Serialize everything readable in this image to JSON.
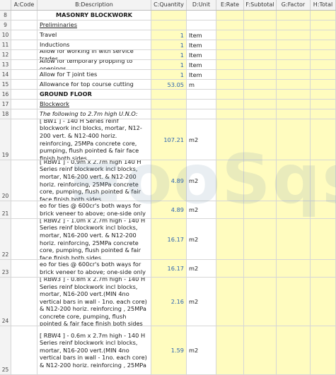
{
  "columns": [
    "",
    "A:Code",
    "B:Description",
    "C:Quantity",
    "D:Unit",
    "E:Rate",
    "F:Subtotal",
    "G:Factor",
    "H:Total"
  ],
  "rows": [
    {
      "num": "8",
      "desc": "MASONRY BLOCKWORK",
      "qty": "",
      "unit": "",
      "style": "b center",
      "h": 14
    },
    {
      "num": "9",
      "desc": "Preliminaries",
      "qty": "",
      "unit": "",
      "style": "u",
      "h": 14
    },
    {
      "num": "10",
      "desc": "Travel",
      "qty": "1",
      "unit": "Item",
      "style": "",
      "h": 14
    },
    {
      "num": "11",
      "desc": "Inductions",
      "qty": "1",
      "unit": "Item",
      "style": "",
      "h": 14
    },
    {
      "num": "12",
      "desc": "Allow for working in with service trades",
      "qty": "1",
      "unit": "Item",
      "style": "",
      "h": 14
    },
    {
      "num": "13",
      "desc": "Allow for temporary propping to openings",
      "qty": "1",
      "unit": "Item",
      "style": "",
      "h": 14
    },
    {
      "num": "14",
      "desc": "Allow for T joint ties",
      "qty": "1",
      "unit": "Item",
      "style": "",
      "h": 14
    },
    {
      "num": "15",
      "desc": "Allowance for top course cutting",
      "qty": "53.05",
      "unit": "m",
      "style": "",
      "h": 14
    },
    {
      "num": "16",
      "desc": "GROUND FLOOR",
      "qty": "",
      "unit": "",
      "style": "b",
      "h": 14
    },
    {
      "num": "17",
      "desc": "Blockwork",
      "qty": "",
      "unit": "",
      "style": "u",
      "h": 14
    },
    {
      "num": "18",
      "desc": "The following to 2.7m high U.N.O:",
      "qty": "",
      "unit": "",
      "style": "i",
      "h": 14
    },
    {
      "num": "19",
      "desc": "[ BW1 ] - 140 H Series reinf blockwork incl blocks, mortar, N12-200 vert. & N12-400 horiz. reinforcing, 25MPa concrete core, pumping, flush pointed & fair face finish both sides",
      "qty": "107.21",
      "unit": "m2",
      "style": "",
      "h": 58
    },
    {
      "num": "20",
      "desc": "[ RBW1 ] - 0.9m x 2.7m high 140 H Series reinf blockwork incl blocks, mortar, N16-200 vert. & N12-200 horiz. reinforcing, 25MPa concrete core, pumping, flush pointed & fair face finish both sides",
      "qty": "4.89",
      "unit": "m2",
      "style": "",
      "h": 58
    },
    {
      "num": "21",
      "desc": "eo for ties @ 600cr's both ways for brick veneer to above; one-side only",
      "qty": "4.89",
      "unit": "m2",
      "style": "",
      "h": 25
    },
    {
      "num": "22",
      "desc": "[ RBW2 ] - 1.0m x 2.7m high - 140 H Series reinf blockwork incl blocks, mortar, N16-200 vert. & N12-200 horiz. reinforcing, 25MPa concrete core, pumping, flush pointed & fair face finish both sides",
      "qty": "16.17",
      "unit": "m2",
      "style": "",
      "h": 58
    },
    {
      "num": "23",
      "desc": "eo for ties @ 600cr's both ways for brick veneer to above; one-side only",
      "qty": "16.17",
      "unit": "m2",
      "style": "",
      "h": 25
    },
    {
      "num": "24",
      "desc": "[ RBW3 ] - 0.8m x 2.7m high - 140 H Series reinf blockwork incl blocks, mortar, N16-200 vert.(MIN 4no vertical bars in wall - 1no. each core) & N12-200 horiz. reinforcing , 25MPa concrete core, pumping, flush pointed & fair face finish both sides",
      "qty": "2.16",
      "unit": "m2",
      "style": "",
      "h": 69
    },
    {
      "num": "25",
      "desc": "[ RBW4 ] - 0.6m x 2.7m high - 140 H Series reinf blockwork incl blocks, mortar, N16-200 vert.(MIN 4no vertical bars in wall - 1no. each core) & N12-200 horiz. reinforcing , 25MPa",
      "qty": "1.59",
      "unit": "m2",
      "style": "",
      "h": 69
    }
  ]
}
